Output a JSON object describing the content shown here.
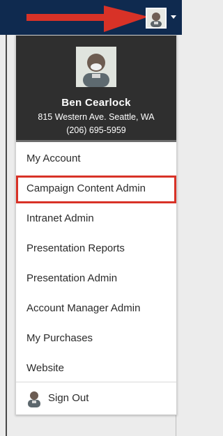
{
  "profile": {
    "name": "Ben Cearlock",
    "address": "815 Western Ave. Seattle, WA",
    "phone": "(206) 695-5959"
  },
  "menu": {
    "items": [
      {
        "label": "My Account"
      },
      {
        "label": "Campaign Content Admin"
      },
      {
        "label": "Intranet Admin"
      },
      {
        "label": "Presentation Reports"
      },
      {
        "label": "Presentation Admin"
      },
      {
        "label": "Account Manager Admin"
      },
      {
        "label": "My Purchases"
      },
      {
        "label": "Website"
      }
    ],
    "signout_label": "Sign Out"
  },
  "colors": {
    "topbar": "#0f2a4f",
    "arrow": "#d83227",
    "highlight": "#d83227",
    "profile_bg": "#2f2f2f"
  },
  "icons": {
    "user_menu": "avatar-icon",
    "dropdown": "caret-down-icon",
    "signout": "avatar-icon"
  }
}
